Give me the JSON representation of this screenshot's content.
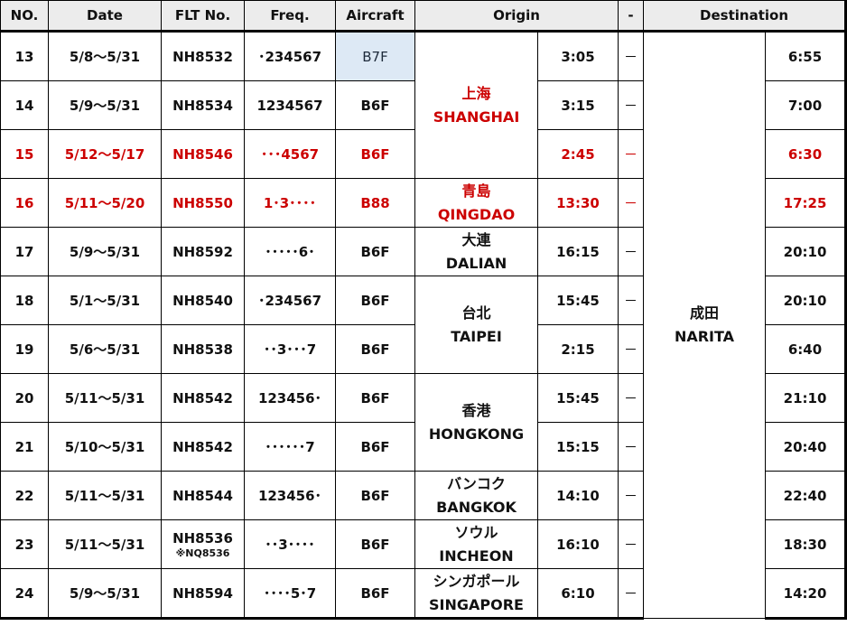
{
  "header": {
    "no": "NO.",
    "date": "Date",
    "flt_no": "FLT No.",
    "freq": "Freq.",
    "aircraft": "Aircraft",
    "origin": "Origin",
    "sep": "-",
    "destination": "Destination"
  },
  "colors": {
    "highlight_text": "#cc0000",
    "header_bg": "#ececec",
    "aircraft_highlight_bg": "#dde9f5"
  },
  "origins": [
    {
      "jp": "上海",
      "en": "SHANGHAI",
      "highlight": true
    },
    {
      "jp": "青島",
      "en": "QINGDAO",
      "highlight": true
    },
    {
      "jp": "大連",
      "en": "DALIAN",
      "highlight": false
    },
    {
      "jp": "台北",
      "en": "TAIPEI",
      "highlight": false
    },
    {
      "jp": "香港",
      "en": "HONGKONG",
      "highlight": false
    },
    {
      "jp": "バンコク",
      "en": "BANGKOK",
      "highlight": false
    },
    {
      "jp": "ソウル",
      "en": "INCHEON",
      "highlight": false
    },
    {
      "jp": "シンガポール",
      "en": "SINGAPORE",
      "highlight": false
    }
  ],
  "destination": {
    "jp": "成田",
    "en": "NARITA"
  },
  "rows": [
    {
      "no": "13",
      "date": "5/8～5/31",
      "flt": "NH8532",
      "flt_note": "",
      "freq": "･234567",
      "aircraft": "B7F",
      "dep": "3:05",
      "sep": "－",
      "arr": "6:55",
      "highlight": false
    },
    {
      "no": "14",
      "date": "5/9～5/31",
      "flt": "NH8534",
      "flt_note": "",
      "freq": "1234567",
      "aircraft": "B6F",
      "dep": "3:15",
      "sep": "－",
      "arr": "7:00",
      "highlight": false
    },
    {
      "no": "15",
      "date": "5/12～5/17",
      "flt": "NH8546",
      "flt_note": "",
      "freq": "･･･4567",
      "aircraft": "B6F",
      "dep": "2:45",
      "sep": "－",
      "arr": "6:30",
      "highlight": true
    },
    {
      "no": "16",
      "date": "5/11～5/20",
      "flt": "NH8550",
      "flt_note": "",
      "freq": "1･3････",
      "aircraft": "B88",
      "dep": "13:30",
      "sep": "－",
      "arr": "17:25",
      "highlight": true
    },
    {
      "no": "17",
      "date": "5/9～5/31",
      "flt": "NH8592",
      "flt_note": "",
      "freq": "･････6･",
      "aircraft": "B6F",
      "dep": "16:15",
      "sep": "－",
      "arr": "20:10",
      "highlight": false
    },
    {
      "no": "18",
      "date": "5/1～5/31",
      "flt": "NH8540",
      "flt_note": "",
      "freq": "･234567",
      "aircraft": "B6F",
      "dep": "15:45",
      "sep": "－",
      "arr": "20:10",
      "highlight": false
    },
    {
      "no": "19",
      "date": "5/6～5/31",
      "flt": "NH8538",
      "flt_note": "",
      "freq": "･･3･･･7",
      "aircraft": "B6F",
      "dep": "2:15",
      "sep": "－",
      "arr": "6:40",
      "highlight": false
    },
    {
      "no": "20",
      "date": "5/11～5/31",
      "flt": "NH8542",
      "flt_note": "",
      "freq": "123456･",
      "aircraft": "B6F",
      "dep": "15:45",
      "sep": "－",
      "arr": "21:10",
      "highlight": false
    },
    {
      "no": "21",
      "date": "5/10～5/31",
      "flt": "NH8542",
      "flt_note": "",
      "freq": "･･････7",
      "aircraft": "B6F",
      "dep": "15:15",
      "sep": "－",
      "arr": "20:40",
      "highlight": false
    },
    {
      "no": "22",
      "date": "5/11～5/31",
      "flt": "NH8544",
      "flt_note": "",
      "freq": "123456･",
      "aircraft": "B6F",
      "dep": "14:10",
      "sep": "－",
      "arr": "22:40",
      "highlight": false
    },
    {
      "no": "23",
      "date": "5/11～5/31",
      "flt": "NH8536",
      "flt_note": "※NQ8536",
      "freq": "･･3････",
      "aircraft": "B6F",
      "dep": "16:10",
      "sep": "－",
      "arr": "18:30",
      "highlight": false
    },
    {
      "no": "24",
      "date": "5/9～5/31",
      "flt": "NH8594",
      "flt_note": "",
      "freq": "････5･7",
      "aircraft": "B6F",
      "dep": "6:10",
      "sep": "－",
      "arr": "14:20",
      "highlight": false
    }
  ]
}
